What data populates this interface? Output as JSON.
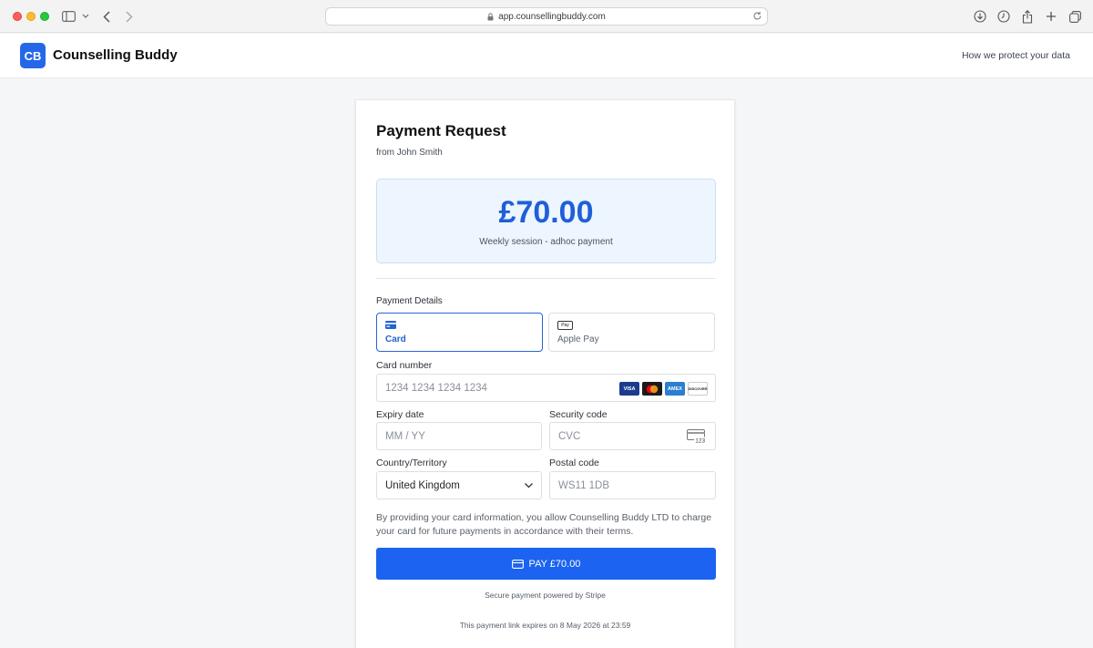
{
  "browser": {
    "url": "app.counsellingbuddy.com",
    "icons": [
      "sidebar-icon",
      "chevron-down-icon",
      "back-icon",
      "forward-icon",
      "lock-icon",
      "reload-icon",
      "download-icon",
      "history-icon",
      "share-icon",
      "plus-icon",
      "tabs-icon"
    ]
  },
  "header": {
    "logo_text": "CB",
    "brand": "Counselling Buddy",
    "protect_link": "How we protect your data"
  },
  "payment": {
    "title": "Payment Request",
    "from": "from John Smith",
    "amount": "£70.00",
    "description": "Weekly session - adhoc payment",
    "details_label": "Payment Details",
    "methods": [
      {
        "label": "Card",
        "icon": "card-icon",
        "selected": true
      },
      {
        "label": "Apple Pay",
        "icon": "apple-pay-icon",
        "badge": "Pay",
        "selected": false
      }
    ],
    "card_number": {
      "label": "Card number",
      "placeholder": "1234 1234 1234 1234",
      "brands": [
        "VISA",
        "",
        "AMEX",
        "DISCOVER"
      ]
    },
    "expiry": {
      "label": "Expiry date",
      "placeholder": "MM / YY"
    },
    "security": {
      "label": "Security code",
      "placeholder": "CVC",
      "icon_text": "123"
    },
    "country": {
      "label": "Country/Territory",
      "value": "United Kingdom"
    },
    "postal": {
      "label": "Postal code",
      "placeholder": "WS11 1DB"
    },
    "consent": "By providing your card information, you allow Counselling Buddy LTD to charge your card for future payments in accordance with their terms.",
    "pay_button": "PAY £70.00",
    "secure_note": "Secure payment powered by Stripe",
    "expiry_note": "This payment link expires on 8 May 2026 at 23:59"
  },
  "colors": {
    "accent": "#1b63f0",
    "amount": "#1f5fd8",
    "amount_bg": "#edf5fe"
  }
}
